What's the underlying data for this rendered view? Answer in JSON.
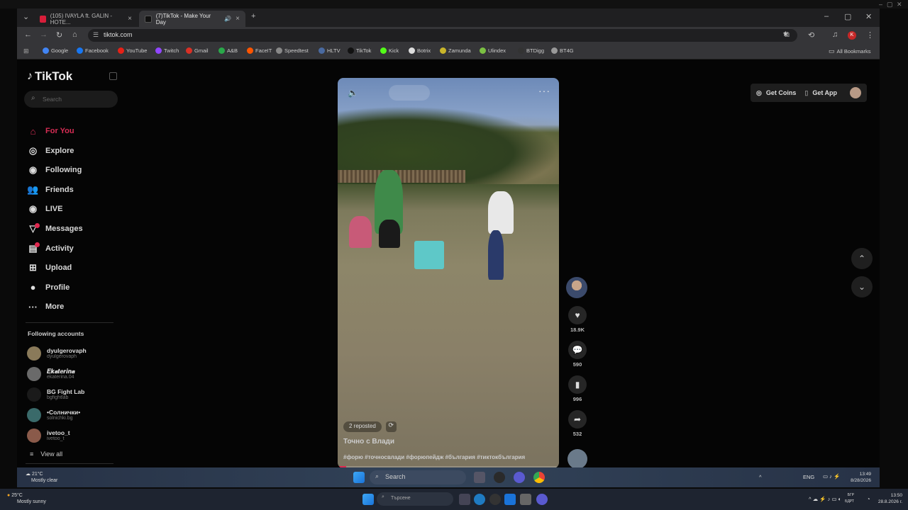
{
  "tabs": [
    {
      "title": "(105) IVAYLA ft. GALIN - HOTE...",
      "color": "#d81e3a"
    },
    {
      "title": "(7)TikTok - Make Your Day",
      "color": "#111111"
    }
  ],
  "url": "tiktok.com",
  "bookmarks": [
    {
      "label": "Google",
      "color": "#4285f4"
    },
    {
      "label": "Facebook",
      "color": "#1877f2"
    },
    {
      "label": "YouTube",
      "color": "#e62117"
    },
    {
      "label": "Twitch",
      "color": "#9146ff"
    },
    {
      "label": "Gmail",
      "color": "#d93025"
    },
    {
      "label": "A&B",
      "color": "#2aa84a"
    },
    {
      "label": "FaceIT",
      "color": "#ff5500"
    },
    {
      "label": "Speedtest",
      "color": "#888888"
    },
    {
      "label": "HLTV",
      "color": "#4a6aa0"
    },
    {
      "label": "TikTok",
      "color": "#111111"
    },
    {
      "label": "Kick",
      "color": "#53fc18"
    },
    {
      "label": "Botrix",
      "color": "#dddddd"
    },
    {
      "label": "Zamunda",
      "color": "#c9b52a"
    },
    {
      "label": "Ulindex",
      "color": "#7bc043"
    },
    {
      "label": "BTDigg",
      "color": "#333333"
    },
    {
      "label": "BT4G",
      "color": "#999999"
    }
  ],
  "all_bookmarks": "All Bookmarks",
  "sidebar": {
    "logo": "TikTok",
    "search_placeholder": "Search",
    "nav": [
      {
        "label": "For You",
        "icon": "home-icon",
        "active": true
      },
      {
        "label": "Explore",
        "icon": "compass-icon"
      },
      {
        "label": "Following",
        "icon": "following-icon"
      },
      {
        "label": "Friends",
        "icon": "friends-icon"
      },
      {
        "label": "LIVE",
        "icon": "live-icon"
      },
      {
        "label": "Messages",
        "icon": "messages-icon",
        "badge": true
      },
      {
        "label": "Activity",
        "icon": "activity-icon",
        "badge": true
      },
      {
        "label": "Upload",
        "icon": "upload-icon"
      },
      {
        "label": "Profile",
        "icon": "profile-icon"
      },
      {
        "label": "More",
        "icon": "more-icon"
      }
    ],
    "following_title": "Following accounts",
    "accounts": [
      {
        "name": "dyulgerovaph",
        "handle": "dyulgerovaph",
        "color": "#8a7a5a"
      },
      {
        "name": "𝑬𝒌𝒂𝒕𝒆𝒓𝒊𝒏𝒂",
        "handle": "ekaterina.04",
        "color": "#6a6a6a"
      },
      {
        "name": "BG Fight Lab",
        "handle": "bgfightlab",
        "color": "#1a1a1a"
      },
      {
        "name": "•Солнички•",
        "handle": "solnichki.bg",
        "color": "#3a6a6a"
      },
      {
        "name": "ivetoo_t",
        "handle": "ivetoo_t",
        "color": "#8a5a4a"
      }
    ],
    "view_all": "View all"
  },
  "header": {
    "get_coins": "Get Coins",
    "get_app": "Get App"
  },
  "video": {
    "reposted": "2 reposted",
    "title": "Точно с Влади",
    "tags": "#форю #точносвлади #форюпейдж #българия #тиктокбългария",
    "progress": 0.04
  },
  "actions": [
    {
      "icon": "heart-icon",
      "count": "18.9K"
    },
    {
      "icon": "comment-icon",
      "count": "590"
    },
    {
      "icon": "bookmark-icon",
      "count": "996"
    },
    {
      "icon": "share-icon",
      "count": "532"
    }
  ],
  "taskbar_inner": {
    "temp": "21°C",
    "weather": "Mostly clear",
    "search": "Search",
    "lang": "ENG",
    "time": "13:49",
    "date": "8/28/2026"
  },
  "taskbar_outer": {
    "temp": "25°C",
    "weather": "Mostly sunny",
    "search": "Търсене",
    "lang_top": "БГР",
    "lang_bot": "БДРТ",
    "time": "13:50",
    "date": "28.8.2026 г."
  }
}
